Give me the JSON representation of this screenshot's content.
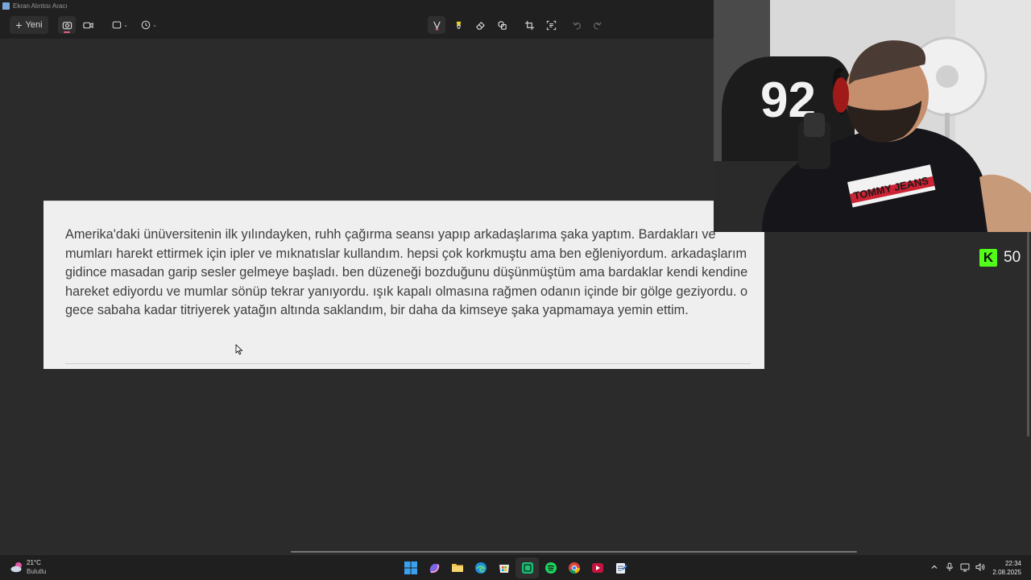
{
  "window": {
    "title": "Ekran Alıntısı Aracı"
  },
  "toolbar": {
    "new_label": "Yeni",
    "tools": [
      "camera-icon",
      "video-icon",
      "rectangle-mode-icon",
      "timer-icon",
      "ballpoint-pen-icon",
      "highlighter-icon",
      "eraser-icon",
      "shapes-icon",
      "crop-icon",
      "text-actions-icon",
      "undo-icon",
      "redo-icon"
    ]
  },
  "document": {
    "paragraph": "Amerika'daki ünüversitenin ilk yılındayken, ruhh çağırma seansı yapıp arkadaşlarıma şaka yaptım. Bardakları ve mumları harekt ettirmek için ipler ve mıknatıslar kullandım. hepsi çok korkmuştu ama ben eğleniyordum. arkadaşlarım gidince masadan garip sesler gelmeye başladı. ben düzeneği bozduğunu düşünmüştüm ama bardaklar kendi kendine hareket ediyordu ve mumlar sönüp tekrar yanıyordu. ışık kapalı olmasına rağmen odanın içinde bir gölge geziyordu. o gece sabaha kadar titriyerek yatağın altında saklandım, bir daha da kimseye şaka yapmamaya yemin ettim."
  },
  "overlay": {
    "viewer_count": "50",
    "brand_color": "#53fc18",
    "jersey_number": "92",
    "shirt_text": "TOMMY JEANS"
  },
  "taskbar": {
    "weather_temp": "21°C",
    "weather_cond": "Bulutlu",
    "apps": [
      "windows-start-icon",
      "copilot-icon",
      "file-explorer-icon",
      "edge-icon",
      "store-icon",
      "snipping-tool-icon",
      "spotify-icon",
      "chrome-icon",
      "media-player-icon",
      "notepad-icon"
    ],
    "time": "22:34",
    "date": "2.08.2025"
  }
}
